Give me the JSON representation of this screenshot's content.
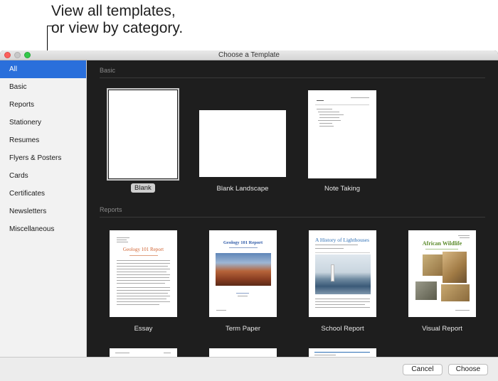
{
  "callout": {
    "line1": "View all templates,",
    "line2": "or view by category."
  },
  "window": {
    "title": "Choose a Template"
  },
  "sidebar": {
    "items": [
      {
        "label": "All",
        "selected": true
      },
      {
        "label": "Basic"
      },
      {
        "label": "Reports"
      },
      {
        "label": "Stationery"
      },
      {
        "label": "Resumes"
      },
      {
        "label": "Flyers & Posters"
      },
      {
        "label": "Cards"
      },
      {
        "label": "Certificates"
      },
      {
        "label": "Newsletters"
      },
      {
        "label": "Miscellaneous"
      }
    ]
  },
  "sections": {
    "basic": {
      "label": "Basic",
      "templates": [
        {
          "name": "Blank",
          "selected": true
        },
        {
          "name": "Blank Landscape"
        },
        {
          "name": "Note Taking"
        }
      ]
    },
    "reports": {
      "label": "Reports",
      "templates": [
        {
          "name": "Essay"
        },
        {
          "name": "Term Paper"
        },
        {
          "name": "School Report"
        },
        {
          "name": "Visual Report"
        }
      ]
    }
  },
  "thumb_text": {
    "essay_title": "Geology 101 Report",
    "termpaper_title": "Geology 101 Report",
    "schoolreport_title": "A History of Lighthouses",
    "visualreport_title": "African Wildlife"
  },
  "colors": {
    "selection": "#2a6fdb",
    "main_bg": "#1e1e1e",
    "sidebar_bg": "#f2f2f2",
    "essay_title": "#d0612f",
    "termpaper_title": "#2e5aa8",
    "schoolreport_title": "#2d6fb5",
    "visualreport_title": "#5a8a2a"
  },
  "footer": {
    "cancel": "Cancel",
    "choose": "Choose"
  }
}
